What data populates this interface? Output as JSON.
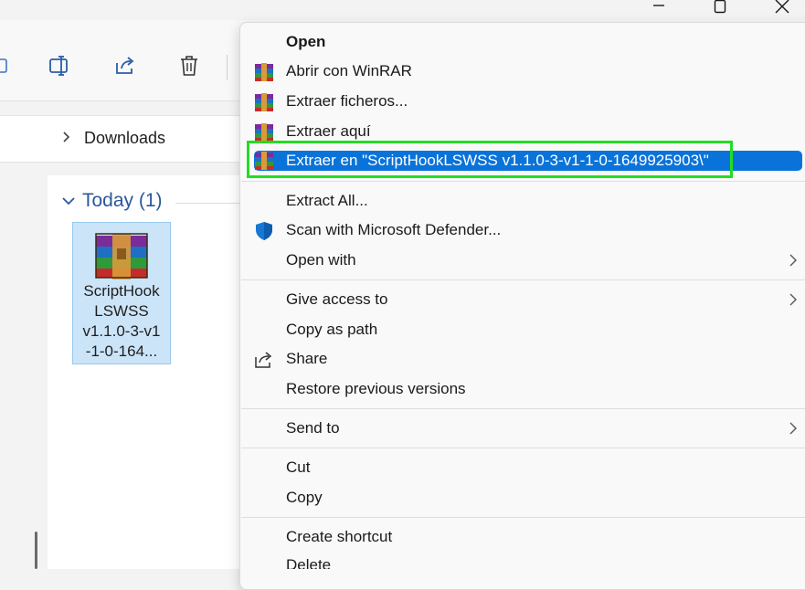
{
  "window": {
    "controls": [
      "minimize-icon",
      "maximize-icon",
      "close-icon"
    ]
  },
  "toolbar": {
    "icons": [
      "rename-icon",
      "share-icon",
      "delete-icon"
    ]
  },
  "breadcrumb": {
    "current": "Downloads"
  },
  "file_list": {
    "group_label": "Today (1)",
    "file": {
      "name": "ScriptHook\nLSWSS\nv1.1.0-3-v1\n-1-0-164...",
      "icon": "winrar-archive-icon",
      "selected": true
    }
  },
  "context_menu": {
    "open": "Open",
    "open_winrar": "Abrir con WinRAR",
    "extract_files": "Extraer ficheros...",
    "extract_here": "Extraer aquí",
    "extract_to": "Extraer en \"ScriptHookLSWSS v1.1.0-3-v1-1-0-1649925903\\\"",
    "extract_all": "Extract All...",
    "scan_defender": "Scan with Microsoft Defender...",
    "open_with": "Open with",
    "give_access": "Give access to",
    "copy_as_path": "Copy as path",
    "share": "Share",
    "restore_versions": "Restore previous versions",
    "send_to": "Send to",
    "cut": "Cut",
    "copy": "Copy",
    "create_shortcut": "Create shortcut",
    "delete": "Delete"
  },
  "colors": {
    "highlight": "#0a73d9",
    "annotation_box": "#22dd22",
    "selection": "#cce4f7",
    "group_header": "#2b579a"
  }
}
